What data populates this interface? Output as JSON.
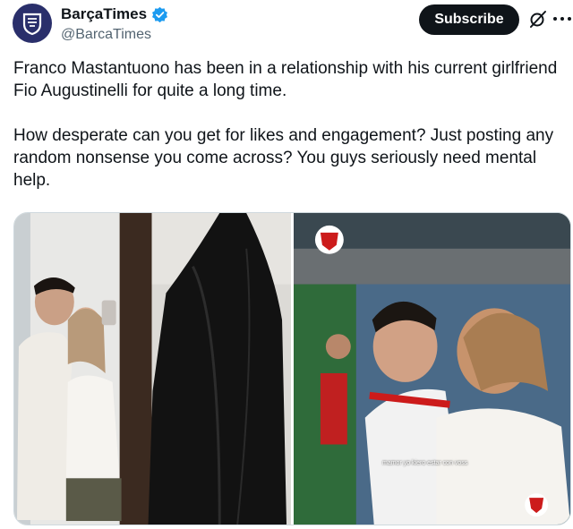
{
  "account": {
    "display_name": "BarçaTimes",
    "handle": "@BarcaTimes",
    "avatar_icon": "club-crest-icon",
    "verified": true,
    "verified_color": "#1d9bf0"
  },
  "actions": {
    "subscribe_label": "Subscribe",
    "grok_icon": "grok-icon",
    "more_icon": "more-dots-icon"
  },
  "tweet": {
    "paragraph_1": "Franco Mastantuono has been in a relationship with his current girlfriend Fio Augustinelli for quite a long time.",
    "paragraph_2": "How desperate can you get for likes and engagement? Just posting any random nonsense you come across? You guys seriously need mental help."
  },
  "media": {
    "photo_count": 2,
    "right_photo_caption": "mamor yo kiero estar con voss"
  },
  "colors": {
    "text": "#0f1419",
    "secondary_text": "#536471",
    "button_bg": "#0f1419",
    "avatar_bg": "#2a2f6b"
  }
}
